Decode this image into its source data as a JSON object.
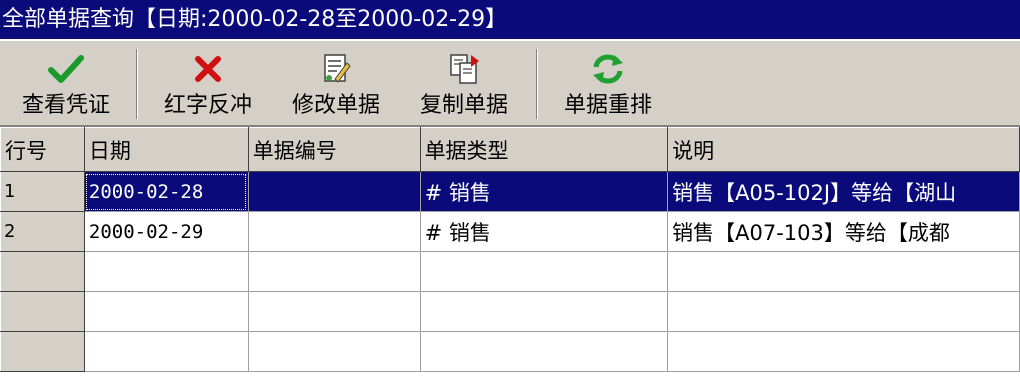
{
  "window": {
    "title": "全部单据查询【日期:2000-02-28至2000-02-29】"
  },
  "toolbar": {
    "buttons": [
      {
        "label": "查看凭证",
        "icon": "checkmark-icon"
      },
      {
        "label": "红字反冲",
        "icon": "red-x-icon"
      },
      {
        "label": "修改单据",
        "icon": "edit-document-icon"
      },
      {
        "label": "复制单据",
        "icon": "copy-document-icon"
      },
      {
        "label": "单据重排",
        "icon": "refresh-arrows-icon"
      }
    ]
  },
  "table": {
    "columns": [
      "行号",
      "日期",
      "单据编号",
      "单据类型",
      "说明"
    ],
    "rows": [
      {
        "row_no": "1",
        "date": "2000-02-28",
        "doc_no": "",
        "doc_type": "# 销售",
        "description": "销售【A05-102J】等给【湖山",
        "selected": true
      },
      {
        "row_no": "2",
        "date": "2000-02-29",
        "doc_no": "",
        "doc_type": "# 销售",
        "description": "销售【A07-103】等给【成都",
        "selected": false
      },
      {
        "row_no": "",
        "date": "",
        "doc_no": "",
        "doc_type": "",
        "description": "",
        "selected": false
      },
      {
        "row_no": "",
        "date": "",
        "doc_no": "",
        "doc_type": "",
        "description": "",
        "selected": false
      },
      {
        "row_no": "",
        "date": "",
        "doc_no": "",
        "doc_type": "",
        "description": "",
        "selected": false
      }
    ]
  },
  "colors": {
    "title_bar": "#0a0a7a",
    "selection": "#0a0a7a",
    "face": "#d4d0c8"
  }
}
